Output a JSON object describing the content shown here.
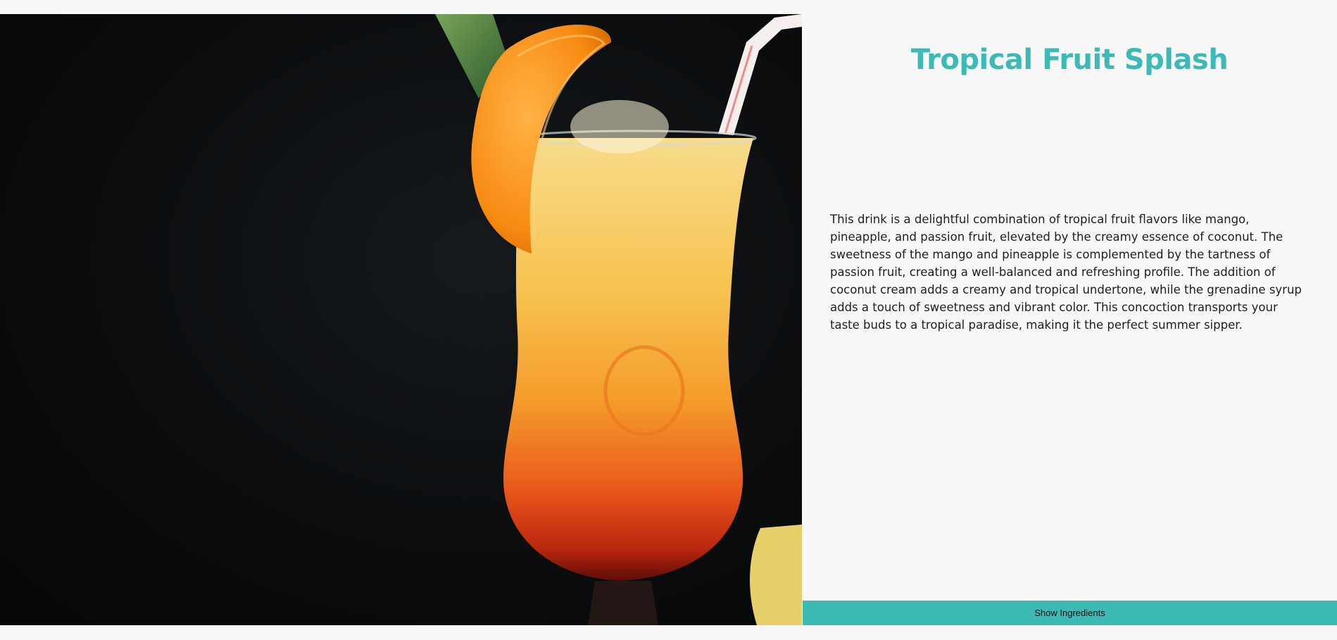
{
  "drink": {
    "title": "Tropical Fruit Splash",
    "description": "This drink is a delightful combination of tropical fruit flavors like mango, pineapple, and passion fruit, elevated by the creamy essence of coconut. The sweetness of the mango and pineapple is complemented by the tartness of passion fruit, creating a well-balanced and refreshing profile. The addition of coconut cream adds a creamy and tropical undertone, while the grenadine syrup adds a touch of sweetness and vibrant color. This concoction transports your taste buds to a tropical paradise, making it the perfect summer sipper."
  },
  "actions": {
    "show_ingredients_label": "Show Ingredients"
  },
  "colors": {
    "accent": "#3bbab6",
    "page_background": "#f8f8f8",
    "photo_background": "#0b0d0f"
  }
}
